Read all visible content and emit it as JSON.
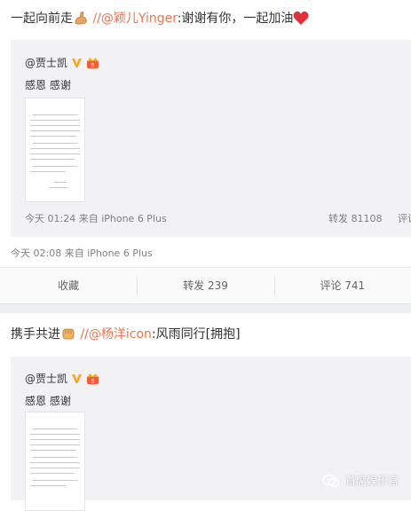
{
  "post1": {
    "text_prefix": "一起向前走",
    "mention": "//@颖儿Yinger",
    "text_suffix": ":谢谢有你，一起加油",
    "quote": {
      "author": "@贾士凯",
      "text": "感恩 感谢",
      "meta_time": "今天 01:24 来自 iPhone 6 Plus",
      "repost": "转发 81108",
      "comment_partial": "评论"
    },
    "meta_time": "今天 02:08 来自 iPhone 6 Plus",
    "actions": {
      "favorite": "收藏",
      "repost": "转发 239",
      "comment": "评论 741"
    }
  },
  "post2": {
    "text_prefix": "携手共进",
    "mention": "//@杨洋icon",
    "text_suffix": ":风雨同行[拥抱]",
    "quote": {
      "author": "@贾士凯",
      "text": "感恩 感谢"
    }
  },
  "watermark": "首席娱乐官",
  "colors": {
    "link": "#eb7350",
    "quote_bg": "#f2f2f5",
    "heart": "#e0303a",
    "vip": "#f5a623"
  }
}
